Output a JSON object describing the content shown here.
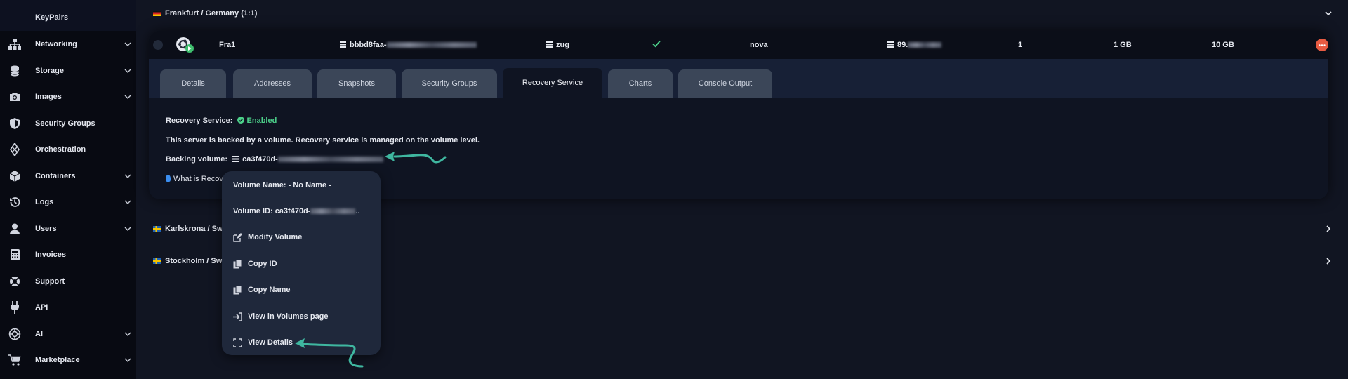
{
  "sidebar": {
    "top_item": "KeyPairs",
    "items": [
      {
        "label": "Networking",
        "icon": "network-icon",
        "has_chevron": true
      },
      {
        "label": "Storage",
        "icon": "database-icon",
        "has_chevron": true
      },
      {
        "label": "Images",
        "icon": "camera-icon",
        "has_chevron": true
      },
      {
        "label": "Security Groups",
        "icon": "shield-icon",
        "has_chevron": false
      },
      {
        "label": "Orchestration",
        "icon": "orchestration-icon",
        "has_chevron": false
      },
      {
        "label": "Containers",
        "icon": "cube-icon",
        "has_chevron": true
      },
      {
        "label": "Logs",
        "icon": "history-icon",
        "has_chevron": true
      },
      {
        "label": "Users",
        "icon": "user-icon",
        "has_chevron": true
      },
      {
        "label": "Invoices",
        "icon": "calculator-icon",
        "has_chevron": false
      },
      {
        "label": "Support",
        "icon": "lifebuoy-icon",
        "has_chevron": false
      },
      {
        "label": "API",
        "icon": "plug-icon",
        "has_chevron": false
      },
      {
        "label": "AI",
        "icon": "ai-icon",
        "has_chevron": true
      },
      {
        "label": "Marketplace",
        "icon": "cart-icon",
        "has_chevron": true
      }
    ]
  },
  "regions": {
    "frankfurt": "Frankfurt / Germany (1:1)",
    "karlskrona": "Karlskrona / Sw",
    "stockholm": "Stockholm / Sw"
  },
  "server": {
    "name": "Fra1",
    "id_prefix": "bbbd8faa-",
    "project": "zug",
    "hypervisor": "nova",
    "ip_prefix": "89.",
    "vcpus": "1",
    "ram": "1 GB",
    "disk": "10 GB"
  },
  "tabs": [
    "Details",
    "Addresses",
    "Snapshots",
    "Security Groups",
    "Recovery Service",
    "Charts",
    "Console Output"
  ],
  "active_tab": "Recovery Service",
  "recovery": {
    "label": "Recovery Service:",
    "status": "Enabled",
    "note": "This server is backed by a volume. Recovery service is managed on the volume level.",
    "backing_label": "Backing volume:",
    "volume_prefix": "ca3f470d-",
    "what_is_link": "What is Recov"
  },
  "menu": {
    "volume_name": "Volume Name: - No Name -",
    "volume_id_prefix": "Volume ID: ca3f470d-",
    "items": [
      {
        "label": "Modify Volume",
        "icon": "edit-icon"
      },
      {
        "label": "Copy ID",
        "icon": "copy-icon"
      },
      {
        "label": "Copy Name",
        "icon": "copy-icon"
      },
      {
        "label": "View in Volumes page",
        "icon": "sign-in-icon"
      },
      {
        "label": "View Details",
        "icon": "expand-icon"
      }
    ]
  },
  "colors": {
    "accent_green": "#4cd08a",
    "arrow_teal": "#3fb7a0",
    "danger": "#e75b42",
    "link_blue": "#3b8ef0"
  }
}
